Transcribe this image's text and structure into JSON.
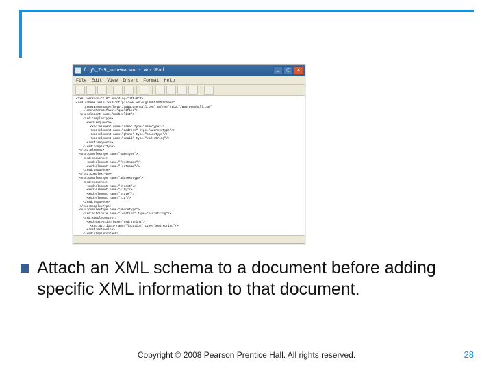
{
  "accent_color": "#1f8fd6",
  "editor": {
    "title_prefix": "◻",
    "title": "fig5_7-9_schema.wo - WordPad",
    "menu": [
      "File",
      "Edit",
      "View",
      "Insert",
      "Format",
      "Help"
    ],
    "window_buttons": {
      "min": "_",
      "max": "▢",
      "close": "✕"
    },
    "code": "<?xml version=\"1.0\" encoding=\"UTF-8\"?>\n<xsd:schema xmlns:xsd=\"http://www.w3.org/2001/XMLSchema\"\n    targetNamespace=\"http://www.prenhall.com\" xmlns=\"http://www.prenhall.com\"\n    elementFormDefault=\"qualified\">\n  <xsd:element name=\"memberlist\">\n    <xsd:complexType>\n      <xsd:sequence>\n        <xsd:element name=\"name\" type=\"nameType\"/>\n        <xsd:element name=\"address\" type=\"addressType\"/>\n        <xsd:element name=\"phone\" type=\"phoneType\"/>\n        <xsd:element name=\"email\" type=\"xsd:string\"/>\n      </xsd:sequence>\n    </xsd:complexType>\n  </xsd:element>\n  <xsd:complexType name=\"nameType\">\n    <xsd:sequence>\n      <xsd:element name=\"firstname\"/>\n      <xsd:element name=\"lastname\"/>\n    </xsd:sequence>\n  </xsd:complexType>\n  <xsd:complexType name=\"addressType\">\n    <xsd:sequence>\n      <xsd:element name=\"street\"/>\n      <xsd:element name=\"city\"/>\n      <xsd:element name=\"state\"/>\n      <xsd:element name=\"zip\"/>\n    </xsd:sequence>\n  </xsd:complexType>\n  <xsd:complexType name=\"phoneType\">\n    <xsd:attribute name=\"location\" type=\"xsd:string\"/>\n    <xsd:simpleContent>\n      <xsd:extension base=\"xsd:string\">\n        <xsd:attribute name=\"location\" type=\"xsd:string\"/>\n      </xsd:extension>\n    </xsd:simpleContent>\n  </xsd:complexType>\n</xsd:schema>"
  },
  "bullet_text": "Attach an XML schema to a document before adding specific XML information to that document.",
  "footer": "Copyright © 2008 Pearson Prentice Hall. All rights reserved.",
  "page_number": "28"
}
